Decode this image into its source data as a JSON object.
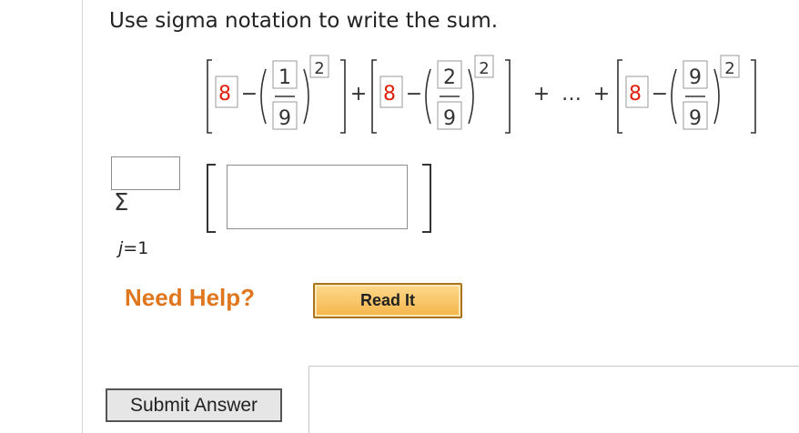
{
  "question": {
    "text": "Use sigma notation to write the sum."
  },
  "expression": {
    "term1": {
      "constant": "8",
      "minus": "−",
      "numerator": "1",
      "denominator": "9",
      "exponent": "2"
    },
    "term2": {
      "constant": "8",
      "minus": "−",
      "numerator": "2",
      "denominator": "9",
      "exponent": "2"
    },
    "term_last": {
      "constant": "8",
      "minus": "−",
      "numerator": "9",
      "denominator": "9",
      "exponent": "2"
    },
    "plus": "+",
    "ellipsis": "…"
  },
  "answer": {
    "sigma_symbol": "Σ",
    "index_var": "j",
    "index_eq": "=",
    "index_start": "1",
    "upper_limit_value": "",
    "term_value": ""
  },
  "help": {
    "label": "Need Help?",
    "read_it": "Read It"
  },
  "submit": {
    "label": "Submit Answer"
  }
}
